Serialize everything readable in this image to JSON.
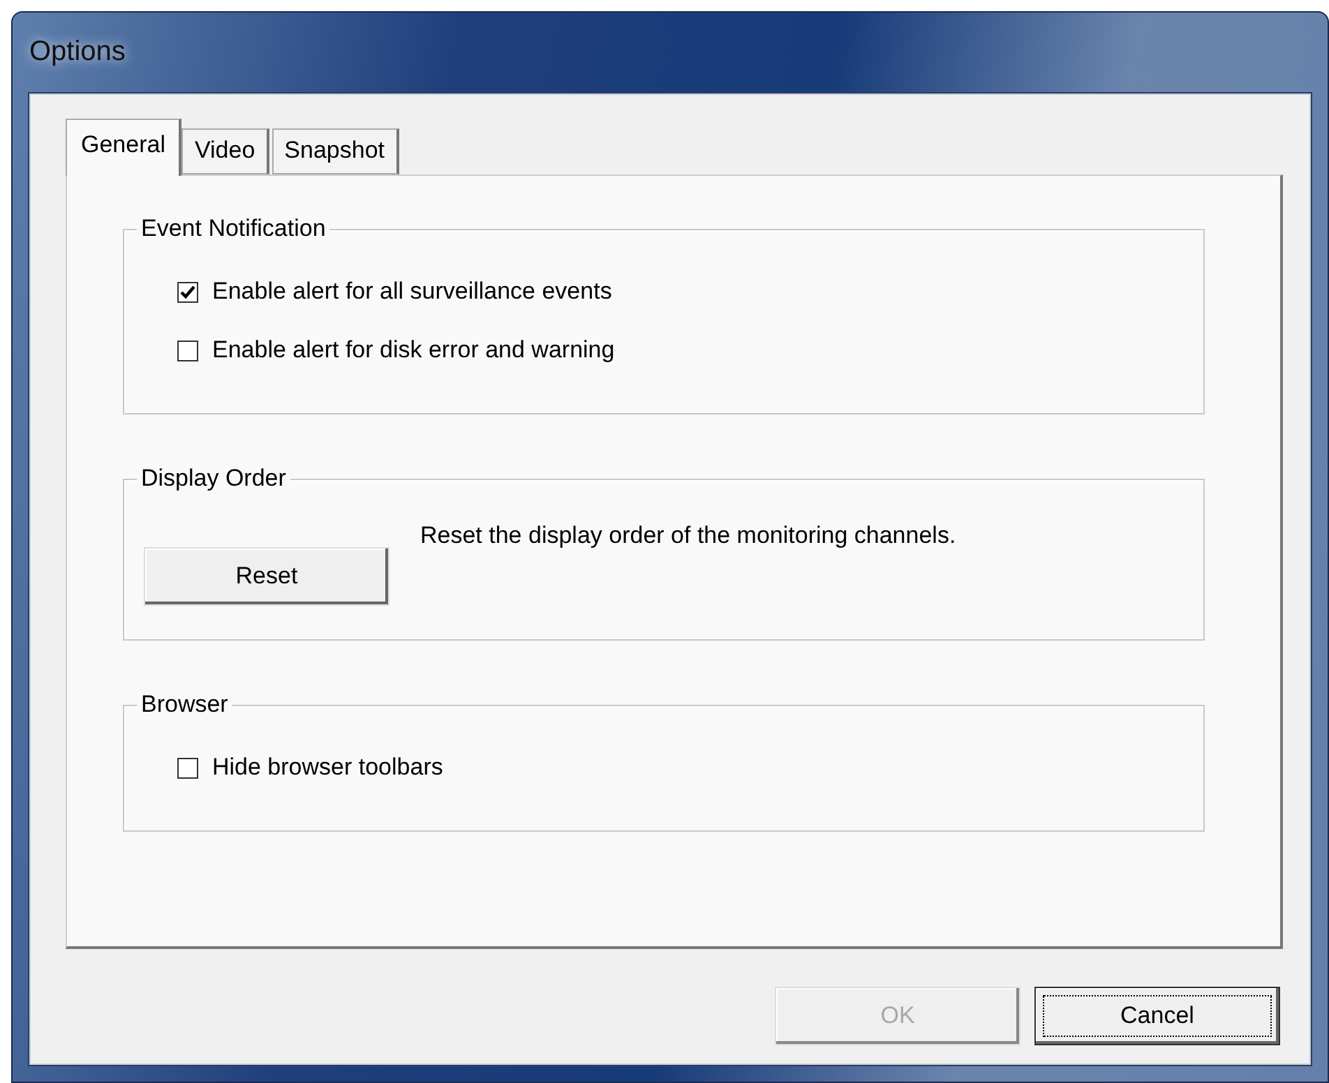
{
  "window": {
    "title": "Options"
  },
  "tabs": [
    {
      "label": "General",
      "selected": true
    },
    {
      "label": "Video",
      "selected": false
    },
    {
      "label": "Snapshot",
      "selected": false
    }
  ],
  "groups": [
    {
      "kind": "checkboxes",
      "title": "Event Notification",
      "items": [
        {
          "label": "Enable alert for all surveillance events",
          "checked": true
        },
        {
          "label": "Enable alert for disk error and warning",
          "checked": false
        }
      ]
    },
    {
      "kind": "action",
      "title": "Display Order",
      "button": "Reset",
      "description": "Reset the display order of the monitoring channels."
    },
    {
      "kind": "checkboxes",
      "title": "Browser",
      "items": [
        {
          "label": "Hide browser toolbars",
          "checked": false
        }
      ]
    }
  ],
  "buttons": [
    {
      "label": "OK",
      "disabled": true,
      "focused": false
    },
    {
      "label": "Cancel",
      "disabled": false,
      "focused": true
    }
  ]
}
